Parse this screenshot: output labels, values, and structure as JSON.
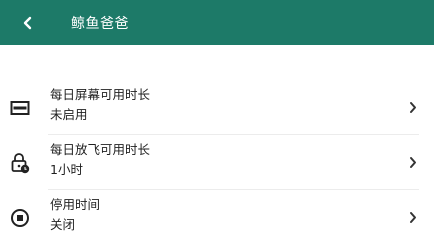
{
  "appbar": {
    "title": "鲸鱼爸爸",
    "back_icon": "chevron-left-icon",
    "background_color": "#1d7a68"
  },
  "settings": [
    {
      "icon": "screen-time-icon",
      "title": "每日屏幕可用时长",
      "value": "未启用"
    },
    {
      "icon": "lock-clock-icon",
      "title": "每日放飞可用时长",
      "value": "1小时"
    },
    {
      "icon": "stop-circle-icon",
      "title": "停用时间",
      "value": "关闭"
    }
  ]
}
